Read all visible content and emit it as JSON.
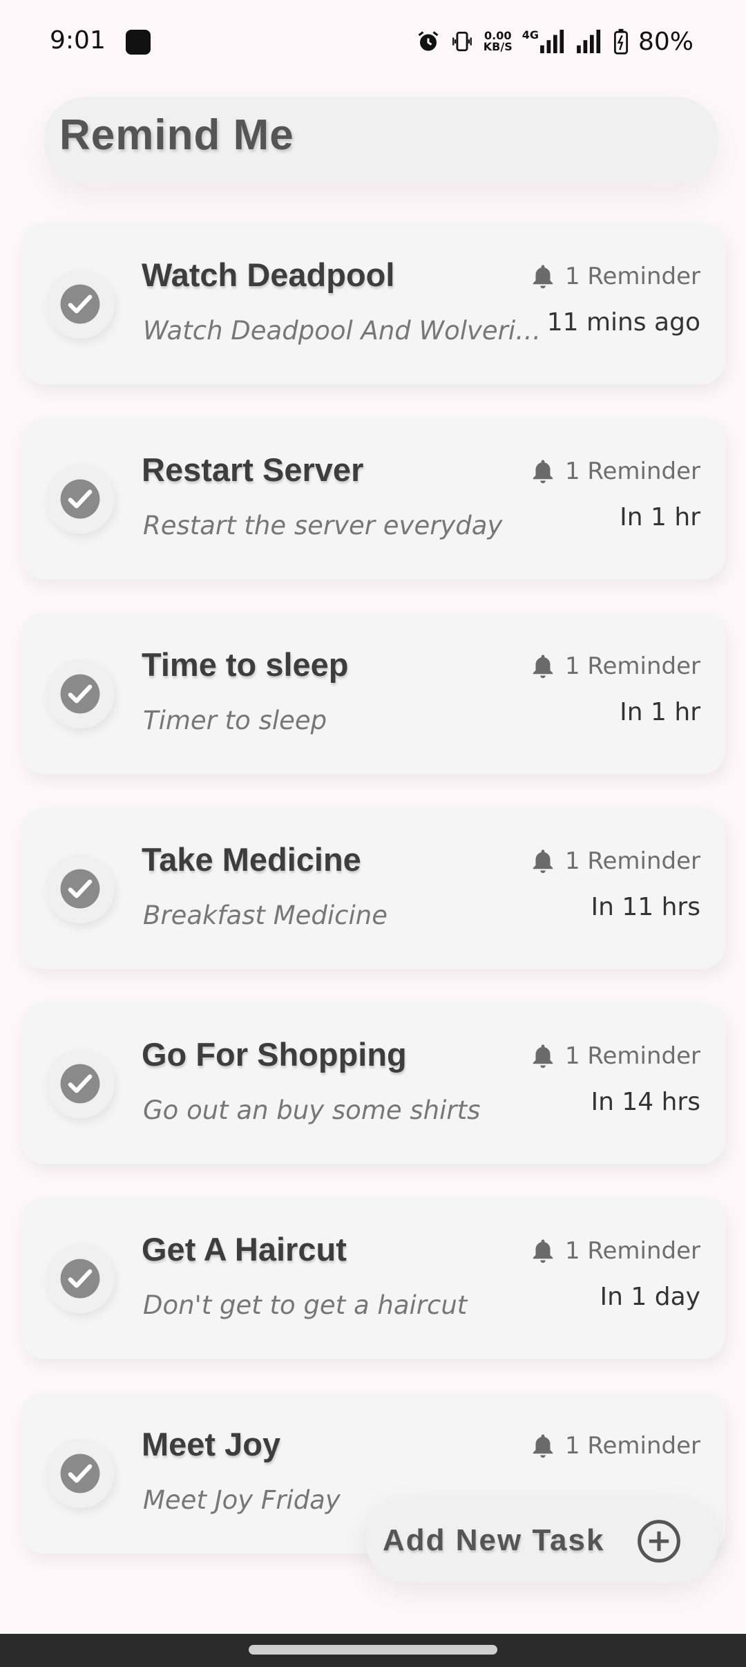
{
  "status_bar": {
    "time": "9:01",
    "speed_value": "0.00",
    "speed_unit": "KB/S",
    "network": "4G",
    "battery": "80%"
  },
  "header": {
    "title": "Remind Me"
  },
  "tasks": [
    {
      "title": "Watch Deadpool",
      "subtitle": "Watch Deadpool And Wolverine",
      "reminders": "1 Reminder",
      "when": "11 mins ago"
    },
    {
      "title": "Restart Server",
      "subtitle": "Restart the server everyday",
      "reminders": "1 Reminder",
      "when": "In 1 hr"
    },
    {
      "title": "Time to sleep",
      "subtitle": "Timer to sleep",
      "reminders": "1 Reminder",
      "when": "In 1 hr"
    },
    {
      "title": "Take Medicine",
      "subtitle": "Breakfast Medicine",
      "reminders": "1 Reminder",
      "when": "In 11 hrs"
    },
    {
      "title": "Go For Shopping",
      "subtitle": "Go out an buy some shirts",
      "reminders": "1 Reminder",
      "when": "In 14 hrs"
    },
    {
      "title": "Get A Haircut",
      "subtitle": "Don't get to get a haircut",
      "reminders": "1 Reminder",
      "when": "In 1 day"
    },
    {
      "title": "Meet Joy",
      "subtitle": "Meet Joy Friday",
      "reminders": "1 Reminder",
      "when": ""
    }
  ],
  "fab": {
    "label": "Add New Task",
    "icon": "add-circle-icon"
  },
  "colors": {
    "background": "#fdf7f9",
    "card": "#f5f5f5",
    "check": "#8a8a8a",
    "navbar": "#2b2b2b"
  }
}
